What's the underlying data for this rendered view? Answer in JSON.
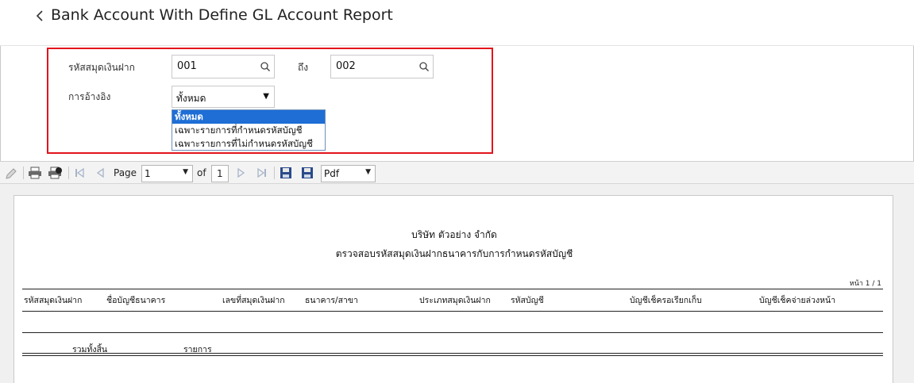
{
  "header": {
    "back_icon": "chevron-left-icon",
    "title": "Bank Account With Define GL Account Report"
  },
  "filters": {
    "code_label": "รหัสสมุดเงินฝาก",
    "code_from": "001",
    "to_label": "ถึง",
    "code_to": "002",
    "search_icon": "search-icon",
    "reference_label": "การอ้างอิง",
    "reference_value": "ทั้งหมด",
    "reference_options": [
      "ทั้งหมด",
      "เฉพาะรายการที่กำหนดรหัสบัญชี",
      "เฉพาะรายการที่ไม่กำหนดรหัสบัญชี"
    ],
    "highlight_color": "#e3141c"
  },
  "toolbar": {
    "page_label": "Page",
    "page_value": "1",
    "of_label": "of",
    "total_pages": "1",
    "export_format": "Pdf",
    "icons": [
      "attach-icon",
      "print-icon",
      "print-preview-icon",
      "first-page-icon",
      "previous-page-icon",
      "next-page-icon",
      "last-page-icon",
      "save-icon",
      "save-as-icon"
    ]
  },
  "report": {
    "company": "บริษัท ตัวอย่าง จำกัด",
    "subtitle": "ตรวจสอบรหัสสมุดเงินฝากธนาคารกับการกำหนดรหัสบัญชี",
    "page_info": "หน้า 1 / 1",
    "columns": [
      "รหัสสมุดเงินฝาก",
      "ชื่อบัญชีธนาคาร",
      "เลขที่สมุดเงินฝาก",
      "ธนาคาร/สาขา",
      "ประเภทสมุดเงินฝาก",
      "รหัสบัญชี",
      "บัญชีเช็ครอเรียกเก็บ",
      "บัญชีเช็คจ่ายล่วงหน้า"
    ],
    "total_label": "รวมทั้งสิ้น",
    "items_label": "รายการ"
  }
}
